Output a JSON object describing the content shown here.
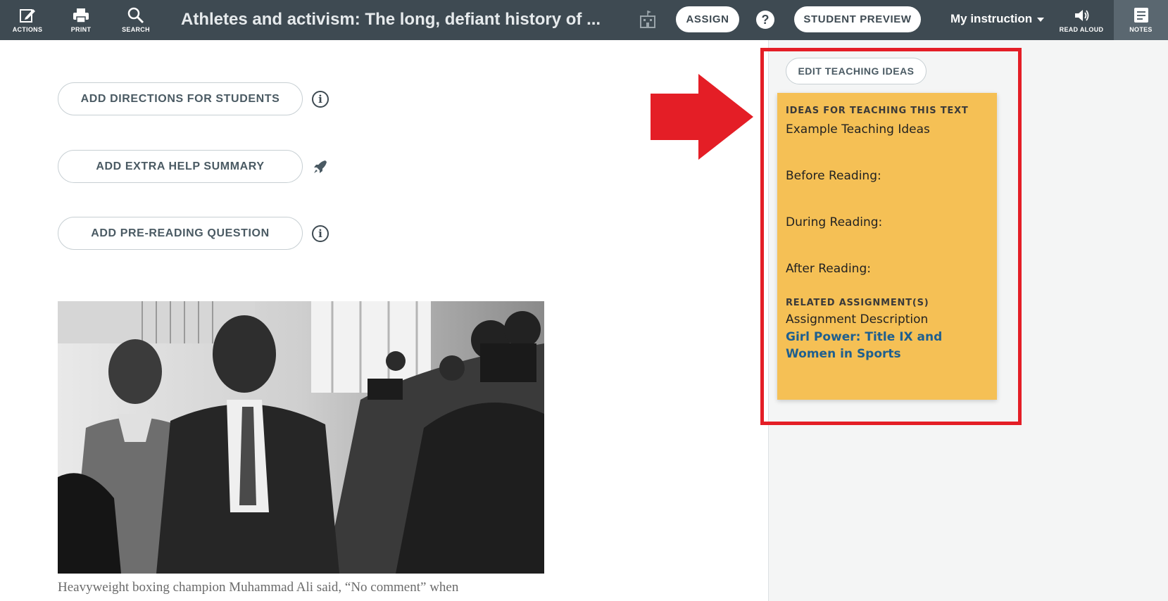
{
  "toolbar": {
    "actions_label": "ACTIONS",
    "print_label": "PRINT",
    "search_label": "SEARCH",
    "title": "Athletes and activism: The long, defiant history of ...",
    "assign_label": "ASSIGN",
    "help_label": "?",
    "student_preview_label": "STUDENT PREVIEW",
    "my_instruction_label": "My instruction",
    "read_aloud_label": "READ ALOUD",
    "notes_label": "NOTES"
  },
  "content": {
    "add_directions_label": "ADD DIRECTIONS FOR STUDENTS",
    "add_extra_help_label": "ADD EXTRA HELP SUMMARY",
    "add_pre_reading_label": "ADD PRE-READING QUESTION",
    "info_glyph": "i",
    "caption": "Heavyweight boxing champion Muhammad Ali said, “No comment” when"
  },
  "notes_panel": {
    "edit_button_label": "EDIT TEACHING IDEAS",
    "ideas_header": "IDEAS FOR TEACHING THIS TEXT",
    "ideas_intro": "Example Teaching Ideas",
    "before_reading": "Before Reading:",
    "during_reading": "During Reading:",
    "after_reading": "After Reading:",
    "related_header": "RELATED ASSIGNMENT(S)",
    "assignment_description": "Assignment Description",
    "assignment_link": "Girl Power: Title IX and Women in Sports"
  },
  "colors": {
    "toolbar_bg": "#3e4a52",
    "note_bg": "#f5c055",
    "annotation_red": "#e41e26",
    "link": "#1e5f8f"
  }
}
